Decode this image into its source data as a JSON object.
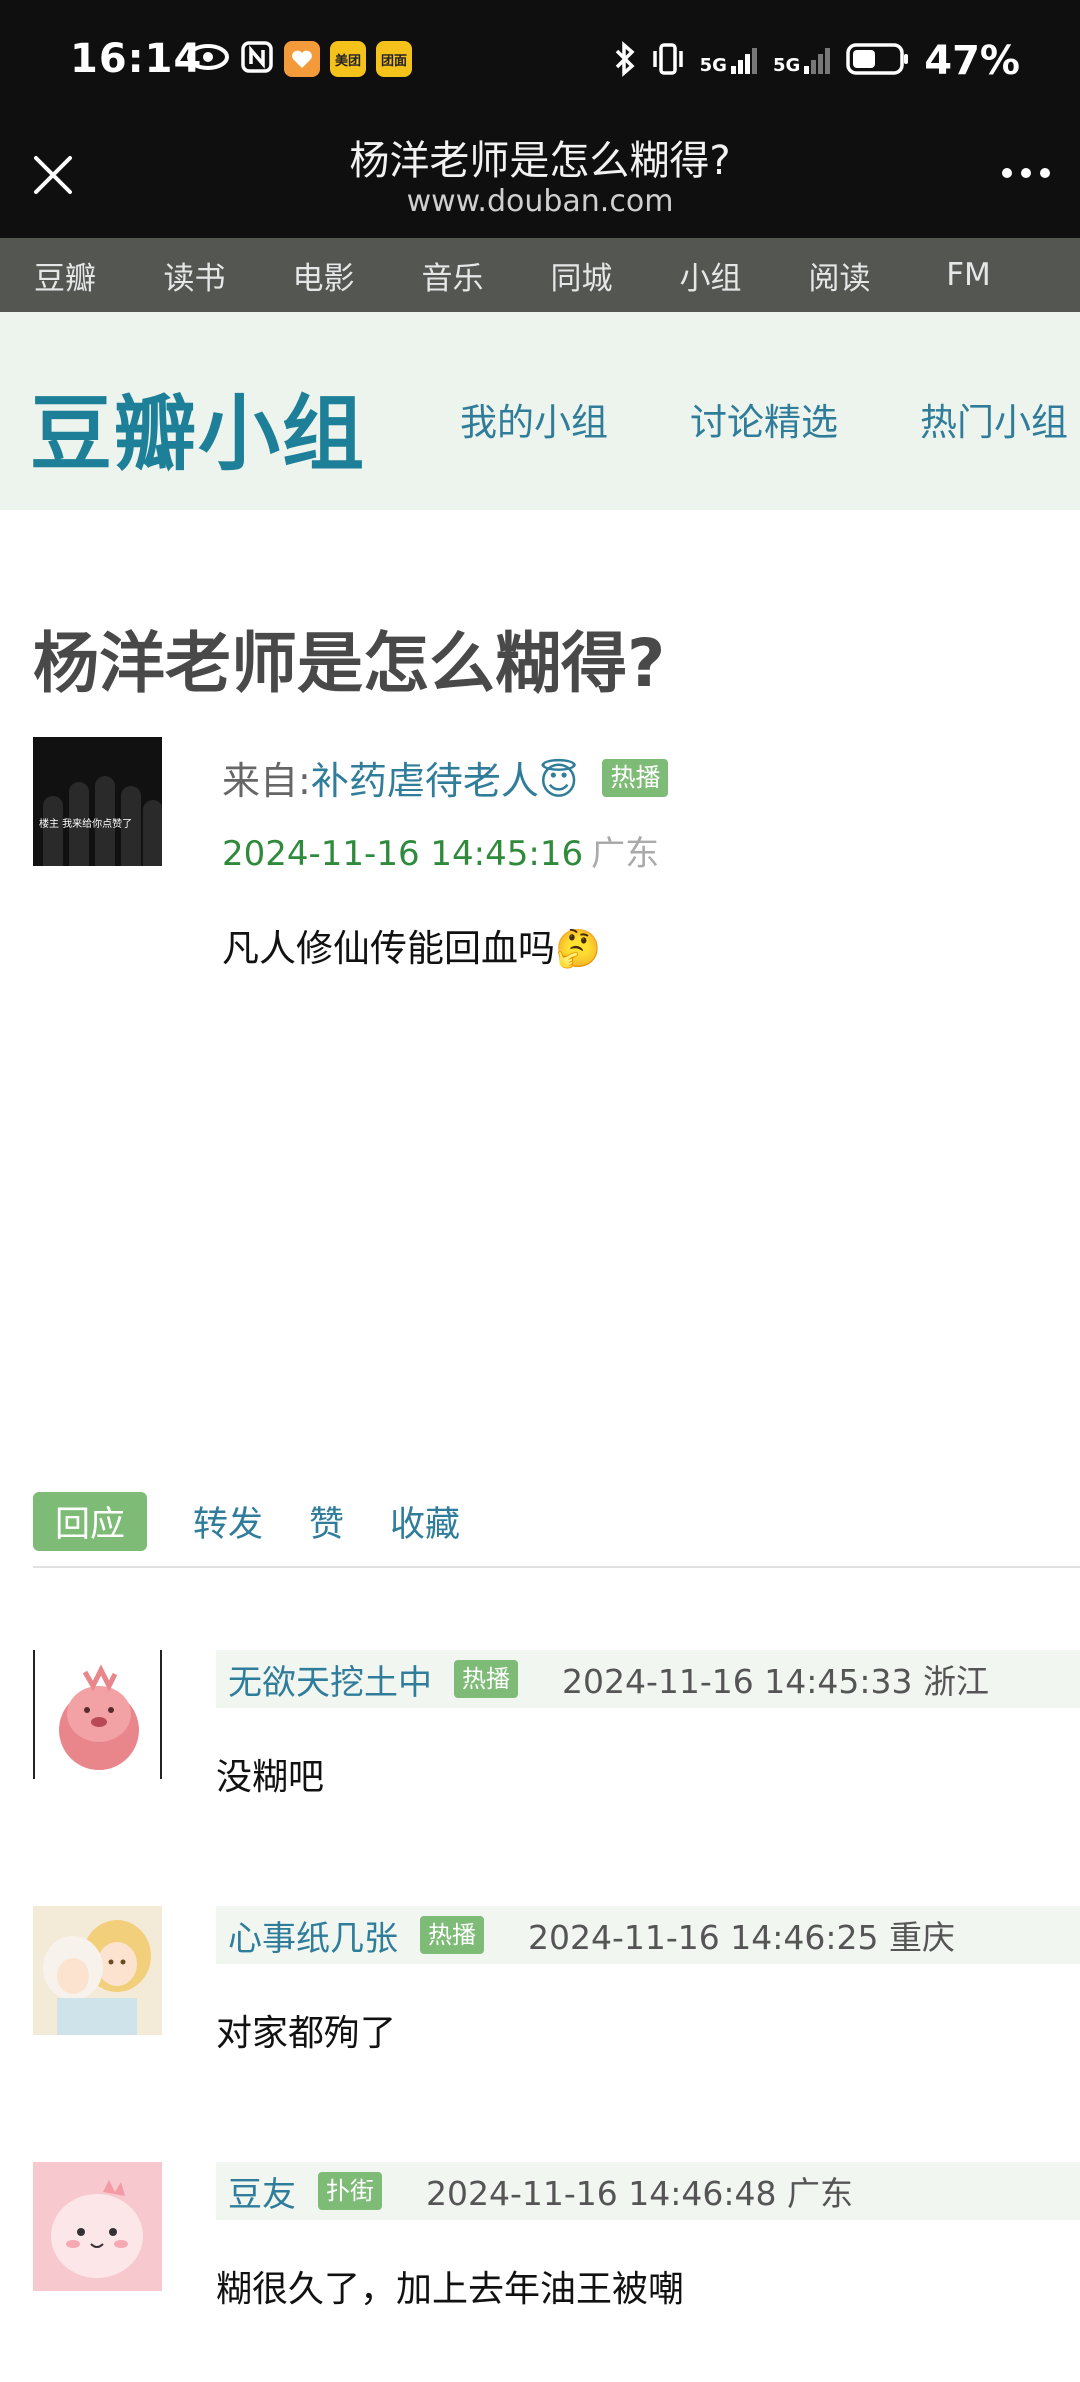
{
  "status_bar": {
    "time": "16:14",
    "app_badges": [
      {
        "label": "",
        "color": "#f39a3b",
        "icon": "heart-app-icon"
      },
      {
        "label": "美团",
        "color": "#f5c21b",
        "icon": "meituan-icon"
      },
      {
        "label": "团面",
        "color": "#f5c21b",
        "icon": "tuanmian-icon"
      }
    ],
    "signal1": "5G",
    "signal2": "5G",
    "battery": "47%"
  },
  "browser": {
    "title": "杨洋老师是怎么糊得?",
    "url": "www.douban.com"
  },
  "site_nav": [
    "豆瓣",
    "读书",
    "电影",
    "音乐",
    "同城",
    "小组",
    "阅读",
    "FM",
    "时"
  ],
  "group": {
    "logo": "豆瓣小组",
    "tabs": [
      "我的小组",
      "讨论精选",
      "热门小组"
    ]
  },
  "post": {
    "title": "杨洋老师是怎么糊得?",
    "from_label": "来自: ",
    "author": "补药虐待老人😇",
    "author_badge": "热播",
    "time": "2024-11-16 14:45:16",
    "location": "广东",
    "body": "凡人修仙传能回血吗🤔",
    "avatar_caption": "楼主 我来给你点赞了"
  },
  "actions": {
    "reply": "回应",
    "share": "转发",
    "like": "赞",
    "collect": "收藏"
  },
  "comments": [
    {
      "name": "无欲天挖土中",
      "badge": "热播",
      "time": "2024-11-16 14:45:33",
      "location": "浙江",
      "text": "没糊吧",
      "avatar_bg": "#ffffff"
    },
    {
      "name": "心事纸几张",
      "badge": "热播",
      "time": "2024-11-16 14:46:25",
      "location": "重庆",
      "text": "对家都殉了",
      "avatar_bg": "#f4ead8"
    },
    {
      "name": "豆友",
      "badge": "扑街",
      "time": "2024-11-16 14:46:48",
      "location": "广东",
      "text": "糊很久了，加上去年油王被嘲",
      "avatar_bg": "#f7c9cf"
    }
  ],
  "colors": {
    "status_bg": "#0f0f0f",
    "nav_bg": "#545652",
    "header_bg": "#edf4ed",
    "link": "#2f7d9a",
    "logo": "#1e8098",
    "badge": "#7dbb76",
    "time_green": "#2f8a3c"
  }
}
